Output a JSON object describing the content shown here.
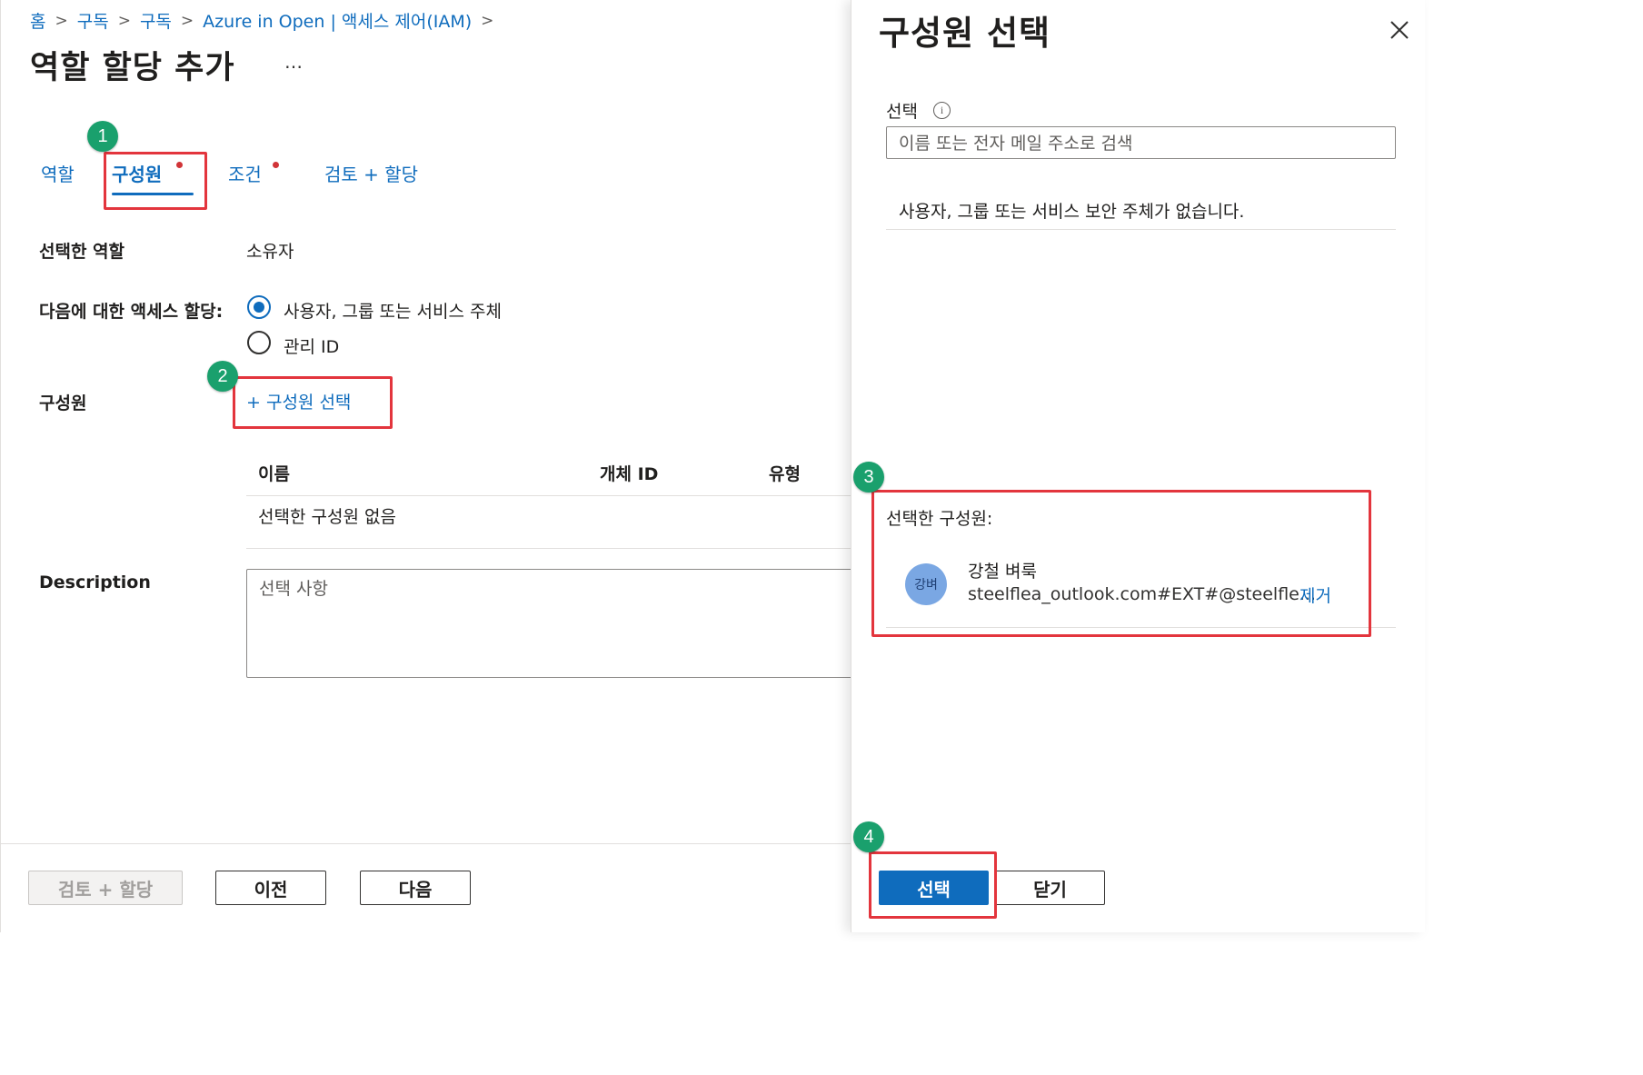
{
  "breadcrumb": [
    "홈",
    "구독",
    "구독",
    "Azure in Open | 액세스 제어(IAM)"
  ],
  "page_title": "역할 할당 추가",
  "more_label": "…",
  "tabs": [
    {
      "label": "역할",
      "active": false
    },
    {
      "label": "구성원",
      "active": true
    },
    {
      "label": "조건",
      "active": false
    },
    {
      "label": "검토 + 할당",
      "active": false
    }
  ],
  "callouts": [
    "1",
    "2",
    "3",
    "4"
  ],
  "form": {
    "selected_role_label": "선택한 역할",
    "selected_role_value": "소유자",
    "assign_access_label": "다음에 대한 액세스 할당:",
    "options": [
      {
        "label": "사용자, 그룹 또는 서비스 주체",
        "checked": true
      },
      {
        "label": "관리 ID",
        "checked": false
      }
    ],
    "members_label": "구성원",
    "select_members_link": "+ 구성원 선택",
    "table_headers": [
      "이름",
      "개체 ID",
      "유형"
    ],
    "empty_members": "선택한 구성원 없음",
    "description_label": "Description",
    "description_placeholder": "선택 사항"
  },
  "footer": {
    "review_assign": "검토 + 할당",
    "previous": "이전",
    "next": "다음"
  },
  "panel": {
    "title": "구성원 선택",
    "select_label": "선택",
    "search_placeholder": "이름 또는 전자 메일 주소로 검색",
    "no_results": "사용자, 그룹 또는 서비스 보안 주체가 없습니다.",
    "selected_members_label": "선택한 구성원:",
    "member": {
      "avatar": "강벼",
      "name": "강철 벼룩",
      "email": "steelflea_outlook.com#EXT#@steelfle...",
      "remove": "제거"
    },
    "select_button": "선택",
    "close_button": "닫기"
  },
  "colors": {
    "accent": "#0f6cbd",
    "callout": "#1aa06d",
    "highlight": "#e3353d",
    "required_dot": "#d13438"
  }
}
